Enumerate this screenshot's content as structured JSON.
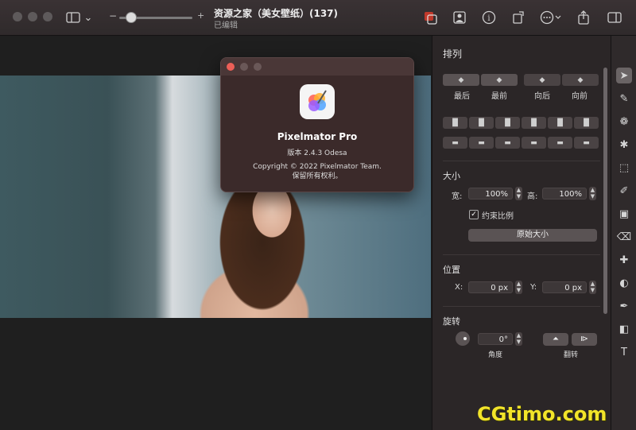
{
  "window": {
    "title": "资源之家（美女壁纸）(137)",
    "subtitle": "已编辑",
    "zoom_minus": "−",
    "zoom_plus": "+"
  },
  "about": {
    "app_name": "Pixelmator Pro",
    "version": "版本 2.4.3 Odesa",
    "copyright": "Copyright © 2022 Pixelmator Team.",
    "rights": "保留所有权利。"
  },
  "inspector": {
    "arrange_title": "排列",
    "order_buttons": [
      "最后",
      "最前",
      "向后",
      "向前"
    ],
    "size_title": "大小",
    "width_label": "宽:",
    "width_value": "100%",
    "height_label": "高:",
    "height_value": "100%",
    "constrain_label": "约束比例",
    "constrain_checked": true,
    "original_size_button": "原始大小",
    "position_title": "位置",
    "x_label": "X:",
    "x_value": "0 px",
    "y_label": "Y:",
    "y_value": "0 px",
    "rotate_title": "旋转",
    "angle_value": "0°",
    "angle_label": "角度",
    "flip_label": "翻转"
  },
  "tools": [
    "arrange-tool-icon",
    "paint-bucket-icon",
    "color-adjust-icon",
    "effects-star-icon",
    "selection-icon",
    "brush-icon",
    "fill-icon",
    "eraser-icon",
    "repair-icon",
    "retouch-icon",
    "pen-icon",
    "shape-icon",
    "type-icon"
  ],
  "watermark": "CGtimo.com",
  "colors": {
    "close": "#ed5f57",
    "accent_yellow": "#f2e42a"
  }
}
